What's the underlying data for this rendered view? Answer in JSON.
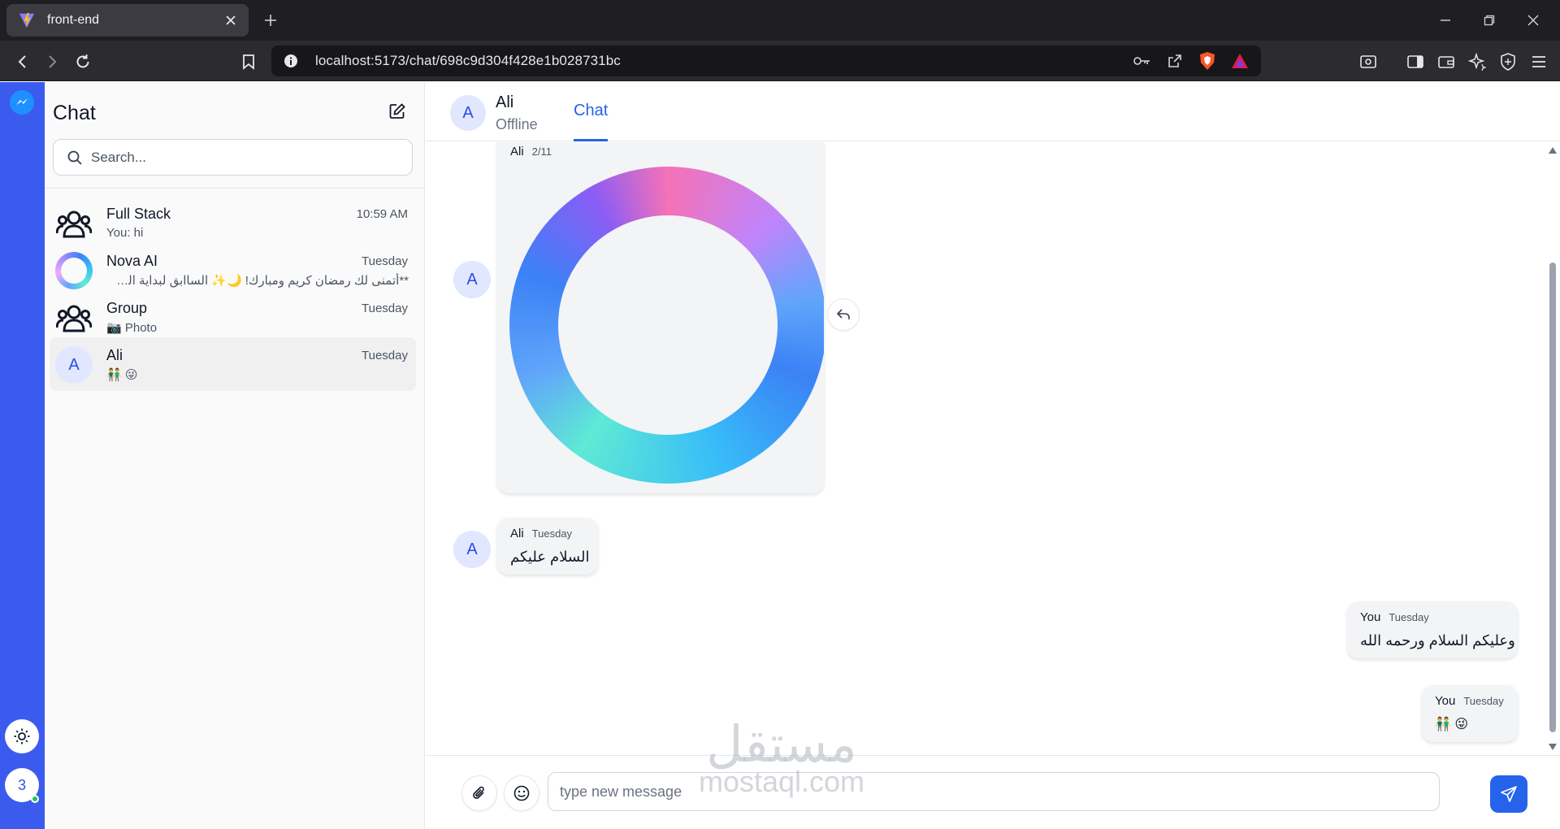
{
  "browser": {
    "tab_title": "front-end",
    "url": "localhost:5173/chat/698c9d304f428e1b028731bc"
  },
  "rail": {
    "user_initial": "3"
  },
  "sidebar": {
    "title": "Chat",
    "search_placeholder": "Search...",
    "conversations": [
      {
        "name": "Full Stack",
        "time": "10:59 AM",
        "preview": "You: hi",
        "avatar": "group-icon"
      },
      {
        "name": "Nova AI",
        "time": "Tuesday",
        "preview": "**أتمنى لك رمضان كريم ومبارك! 🌙✨ الساابق لبداية الشهر الهجري.",
        "avatar": "ring-gradient"
      },
      {
        "name": "Group",
        "time": "Tuesday",
        "preview": "📷 Photo",
        "avatar": "group-icon"
      },
      {
        "name": "Ali",
        "time": "Tuesday",
        "preview": "👬 😜",
        "avatar": "A",
        "active": true
      }
    ]
  },
  "chat": {
    "contact_name": "Ali",
    "contact_initial": "A",
    "contact_status": "Offline",
    "active_tab": "Chat",
    "messages": [
      {
        "sender": "Ali",
        "time": "2/11",
        "type": "image"
      },
      {
        "sender": "Ali",
        "time": "Tuesday",
        "text": "السلام عليكم"
      },
      {
        "sender": "You",
        "time": "Tuesday",
        "text": "وعليكم السلام ورحمه الله"
      },
      {
        "sender": "You",
        "time": "Tuesday",
        "text": "👬 😜"
      }
    ],
    "input_placeholder": "type new message"
  },
  "watermark": {
    "arabic": "مستقل",
    "latin": "mostaql.com"
  },
  "colors": {
    "rail": "#3b5bef",
    "accent": "#2563eb",
    "bubble": "#f3f4f6"
  }
}
